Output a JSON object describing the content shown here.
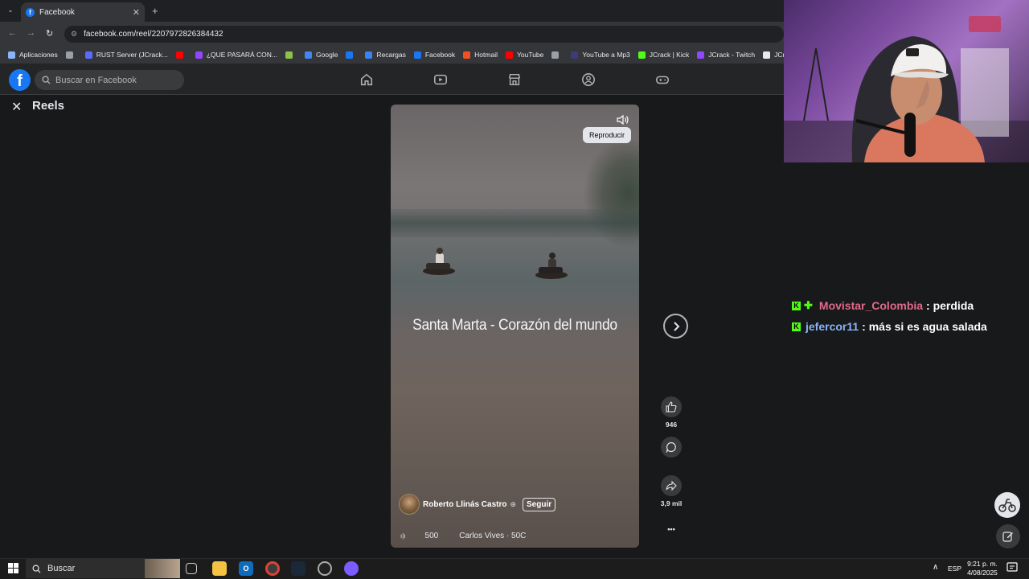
{
  "browser": {
    "tab_title": "Facebook",
    "tab_close": "✕",
    "tab_list": "⌄",
    "new_tab": "+",
    "url": "facebook.com/reel/2207972826384432",
    "nav": {
      "back": "←",
      "forward": "→",
      "reload": "↻"
    },
    "bookmarks": [
      {
        "label": "Aplicaciones",
        "color": "#8ab4f8"
      },
      {
        "label": "",
        "color": "#9aa0a6"
      },
      {
        "label": "RUST Server (JCrack...",
        "color": "#5b6bff"
      },
      {
        "label": "",
        "color": "#ff0000"
      },
      {
        "label": "¿QUE PASARÁ CON...",
        "color": "#9146ff"
      },
      {
        "label": "",
        "color": "#8bc34a"
      },
      {
        "label": "Google",
        "color": "#4285f4"
      },
      {
        "label": "",
        "color": "#1877f2"
      },
      {
        "label": "Recargas",
        "color": "#3b82f6"
      },
      {
        "label": "Facebook",
        "color": "#1877f2"
      },
      {
        "label": "Hotmail",
        "color": "#f25022"
      },
      {
        "label": "YouTube",
        "color": "#ff0000"
      },
      {
        "label": "",
        "color": "#9aa0a6"
      },
      {
        "label": "YouTube a Mp3",
        "color": "#3c3c7a"
      },
      {
        "label": "JCrack | Kick",
        "color": "#53fc18"
      },
      {
        "label": "JCrack - Twitch",
        "color": "#9146ff"
      },
      {
        "label": "JCrack (@JCrac",
        "color": "#e8eaed"
      }
    ]
  },
  "facebook": {
    "logo": "f",
    "search_placeholder": "Buscar en Facebook",
    "reels_title": "Reels",
    "close_icon": "✕"
  },
  "reel": {
    "overlay_text": "Santa Marta - Corazón del mundo",
    "tooltip": "Reproducir",
    "author": "Roberto Llinás Castro",
    "globe": "⊕",
    "follow_label": "Seguir",
    "audio_bars": "ı|ı",
    "audio_count": "500",
    "audio_title": "Carlos Vives · 50C",
    "likes": "946",
    "shares": "3,9 mil",
    "more": "•••"
  },
  "chat": [
    {
      "user": "Movistar_Colombia",
      "color": "#e16a8a",
      "message": ": perdida",
      "has_plus_badge": true
    },
    {
      "user": "jefercor11",
      "color": "#8ab4f8",
      "message": ": más si es agua salada",
      "has_plus_badge": false
    }
  ],
  "chat_badge": {
    "kick": "K",
    "plus": "✚"
  },
  "taskbar": {
    "search_placeholder": "Buscar",
    "language": "ESP",
    "time": "9:21 p. m.",
    "date": "4/08/2025",
    "tray_up": "∧"
  },
  "colors": {
    "facebook_blue": "#1877f2",
    "kick_green": "#53fc18"
  }
}
